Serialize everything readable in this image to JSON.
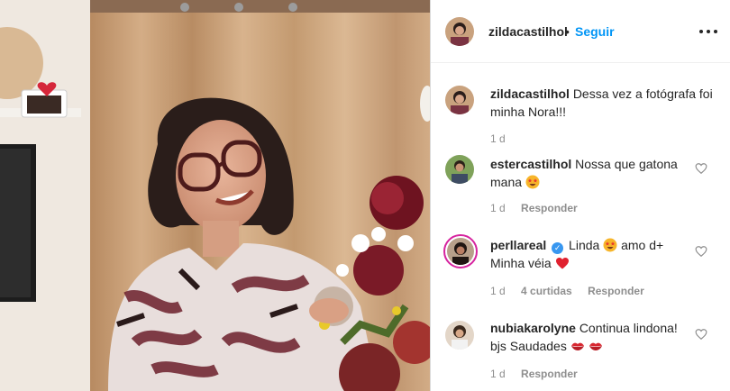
{
  "header": {
    "username": "zildacastilhol",
    "separator": "•",
    "follow_label": "Seguir"
  },
  "caption": {
    "username": "zildacastilhol",
    "text": "Dessa vez a fotógrafa foi minha Nora!!!",
    "time": "1 d"
  },
  "comments": [
    {
      "username": "estercastilhol",
      "text": "Nossa que gatona mana",
      "emoji": "star-struck",
      "time": "1 d",
      "reply_label": "Responder"
    },
    {
      "username": "perllareal",
      "verified": true,
      "text_before": "Linda",
      "text_middle": "amo d+ Minha véia",
      "emoji_1": "star-struck",
      "emoji_2": "red-heart",
      "time": "1 d",
      "likes": "4 curtidas",
      "reply_label": "Responder"
    },
    {
      "username": "nubiakarolyne",
      "text": "Continua lindona! bjs Saudades",
      "emoji": "kiss-mark",
      "time": "1 d",
      "reply_label": "Responder"
    }
  ],
  "colors": {
    "accent": "#0095f6",
    "verified": "#3897f0",
    "muted": "#8e8e8e",
    "text": "#262626",
    "heart": "#ed4956"
  }
}
